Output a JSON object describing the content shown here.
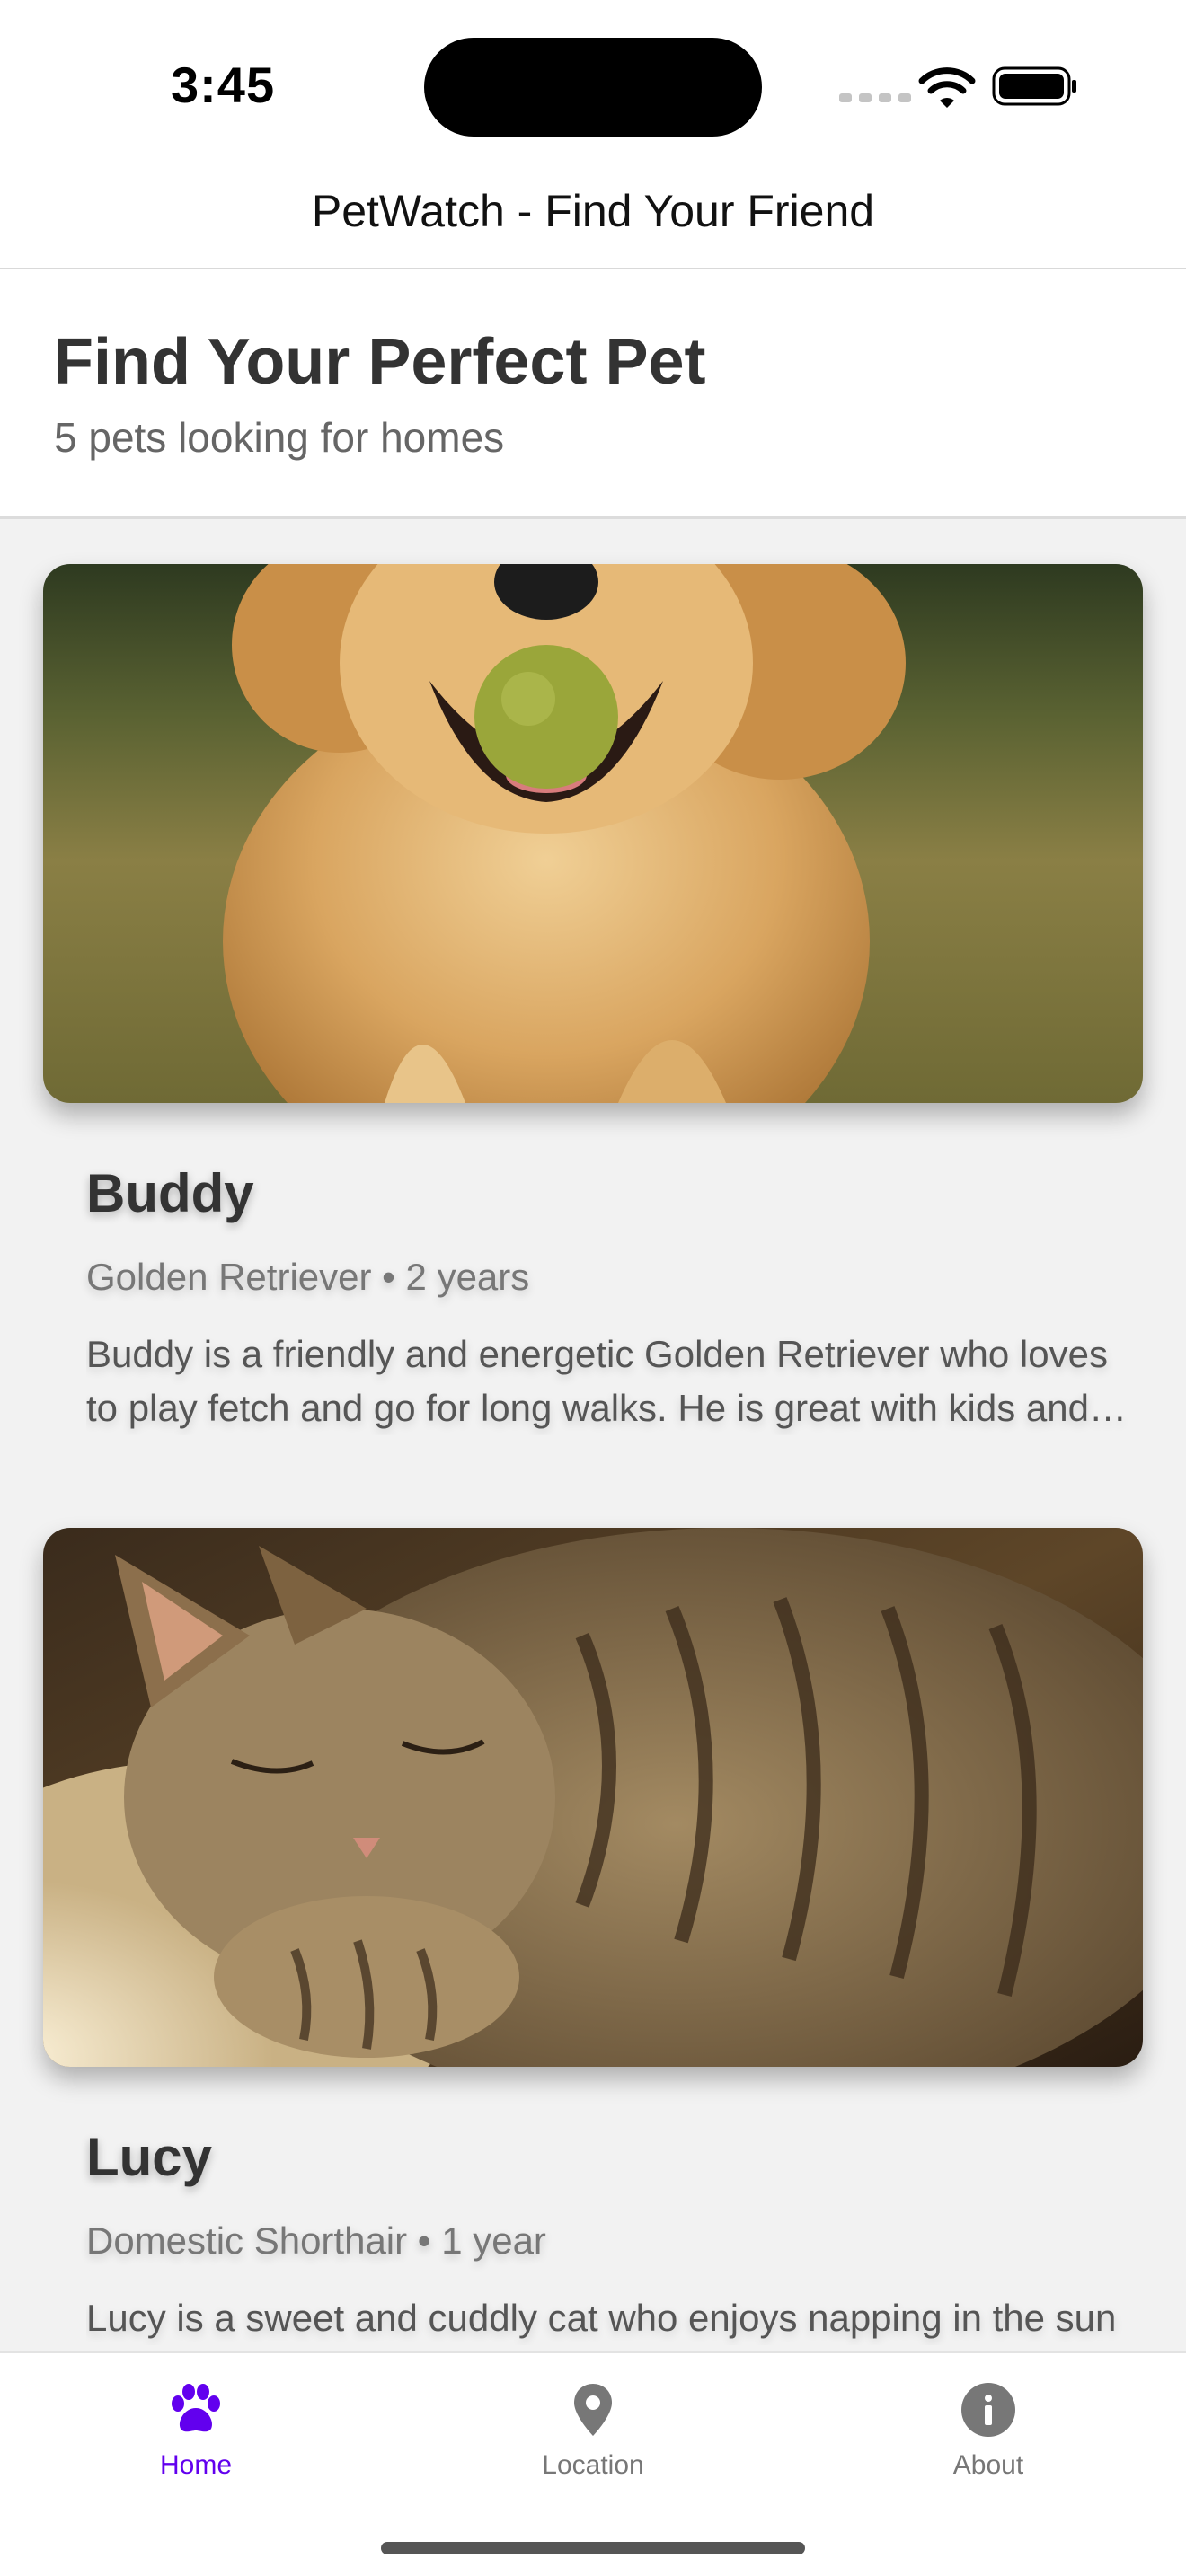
{
  "status_bar": {
    "time": "3:45"
  },
  "header": {
    "title": "PetWatch - Find Your Friend"
  },
  "intro": {
    "title": "Find Your Perfect Pet",
    "subtitle": "5 pets looking for homes"
  },
  "pets": [
    {
      "name": "Buddy",
      "breed": "Golden Retriever",
      "age": "2 years",
      "description": "Buddy is a friendly and energetic Golden Retriever who loves to play fetch and go for long walks. He is great with kids and other dogs.",
      "image_icon": "golden-retriever-photo"
    },
    {
      "name": "Lucy",
      "breed": "Domestic Shorthair",
      "age": "1 year",
      "description": "Lucy is a sweet and cuddly cat who enjoys napping in the sun",
      "image_icon": "tabby-cat-photo"
    }
  ],
  "meta_separator": "•",
  "tabs": [
    {
      "label": "Home",
      "icon": "paw-icon",
      "active": true
    },
    {
      "label": "Location",
      "icon": "map-pin-icon",
      "active": false
    },
    {
      "label": "About",
      "icon": "info-icon",
      "active": false
    }
  ],
  "colors": {
    "accent": "#6200ee",
    "inactive": "#777777"
  }
}
